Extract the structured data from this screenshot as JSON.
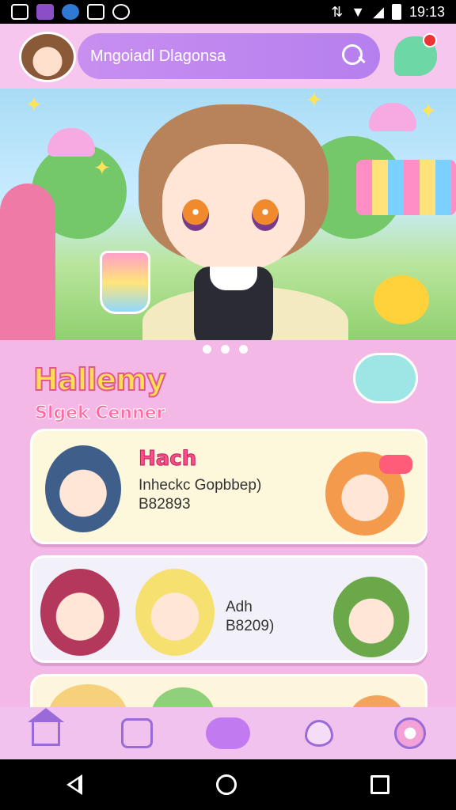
{
  "status_bar": {
    "time": "19:13",
    "icons": [
      "notification-icon",
      "app-icon",
      "shield-icon",
      "square-icon",
      "alarm-icon",
      "vibrate-icon",
      "wifi-icon",
      "signal-icon",
      "battery-icon"
    ]
  },
  "header": {
    "search_text": "Mngoiadl Dlagonsa",
    "notification_badge": ""
  },
  "banner": {
    "page_indicators": 3,
    "active_indicator": 1
  },
  "section": {
    "title": "Hallemy",
    "subtitle": "Slgek Cenner"
  },
  "cards": [
    {
      "title": "Hach",
      "line1": "Inheckc Gopbbep)",
      "line2": "B82893",
      "tag": ""
    },
    {
      "title": "",
      "line1": "Adh",
      "line2": "B8209)"
    },
    {
      "title": "",
      "line1": "",
      "line2": ""
    }
  ],
  "bottom_nav": [
    "home-icon",
    "book-icon",
    "center-icon",
    "heart-icon",
    "profile-icon"
  ],
  "colors": {
    "background": "#f3b8e6",
    "search_bar": "#c88ef0",
    "accent_pink": "#ff4d8b",
    "accent_purple": "#9a6bd8"
  }
}
